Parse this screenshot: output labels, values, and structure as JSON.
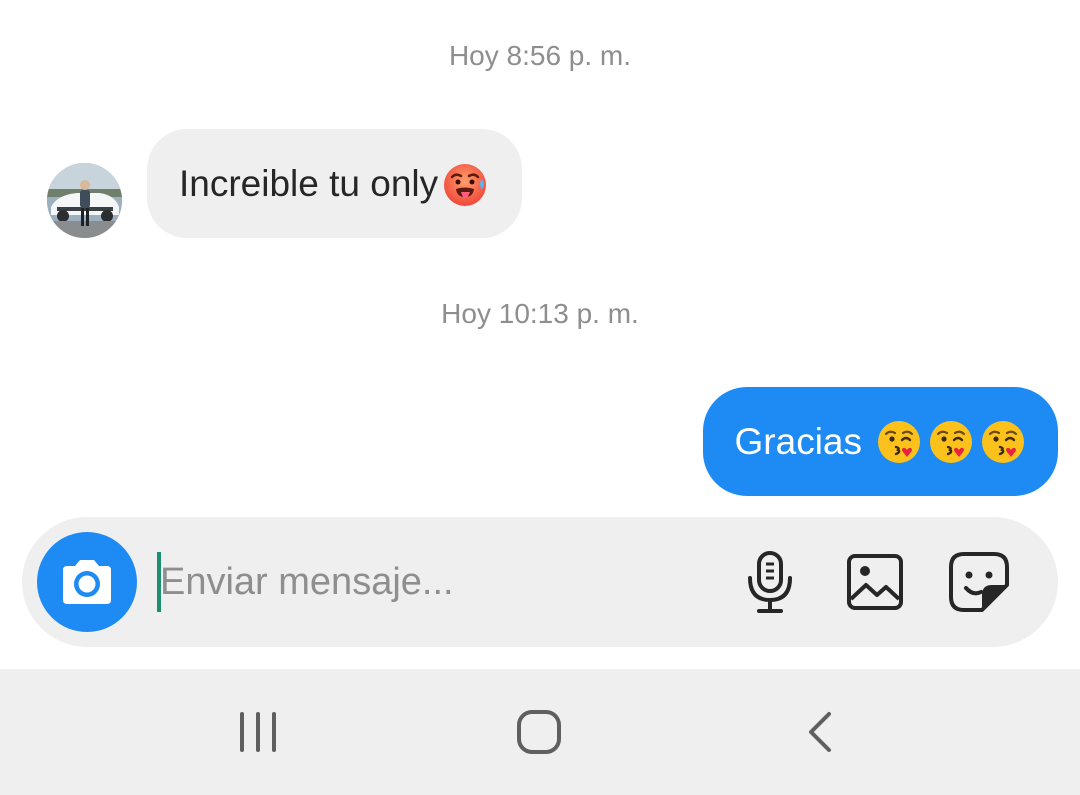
{
  "conversation": {
    "messages": [
      {
        "timestamp": "Hoy 8:56 p. m.",
        "direction": "incoming",
        "text": "Increible tu only",
        "emoji": [
          "hot-face"
        ]
      },
      {
        "timestamp": "Hoy 10:13 p. m.",
        "direction": "outgoing",
        "text": "Gracias ",
        "emoji": [
          "face-blowing-kiss",
          "face-blowing-kiss",
          "face-blowing-kiss"
        ]
      }
    ]
  },
  "composer": {
    "placeholder": "Enviar mensaje...",
    "value": "",
    "icons": [
      "camera-icon",
      "microphone-icon",
      "gallery-icon",
      "sticker-icon"
    ]
  },
  "navigation": {
    "buttons": [
      "recents-icon",
      "home-icon",
      "back-icon"
    ]
  },
  "colors": {
    "accent": "#1e8af3",
    "incoming_bubble": "#efefef",
    "timestamp_text": "#8e8e8e",
    "caret": "#1a8f73"
  }
}
